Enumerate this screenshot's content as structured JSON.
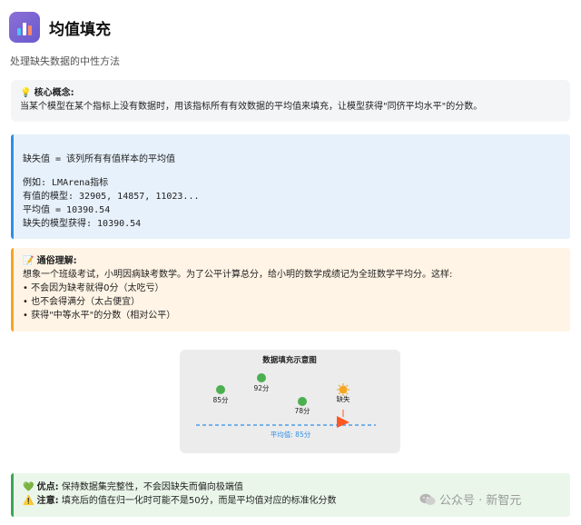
{
  "header": {
    "icon": "bar-chart-icon",
    "title": "均值填充"
  },
  "subtitle": "处理缺失数据的中性方法",
  "core": {
    "icon": "lightbulb-icon",
    "label": "核心概念:",
    "text": "当某个模型在某个指标上没有数据时，用该指标所有有效数据的平均值来填充，让模型获得\"同侪平均水平\"的分数。"
  },
  "formula": {
    "line1": "缺失值 = 该列所有有值样本的平均值",
    "line2": "例如: LMArena指标",
    "line3": "有值的模型: 32905, 14857, 11023...",
    "line4": "平均值 = 10390.54",
    "line5": "缺失的模型获得: 10390.54"
  },
  "plain": {
    "icon": "memo-icon",
    "label": "通俗理解:",
    "intro": "想象一个班级考试，小明因病缺考数学。为了公平计算总分，给小明的数学成绩记为全班数学平均分。这样:",
    "bullets": [
      "• 不会因为缺考就得0分（太吃亏）",
      "• 也不会得满分（太占便宜）",
      "• 获得\"中等水平\"的分数（相对公平）"
    ]
  },
  "diagram": {
    "title": "数据填充示意图",
    "points": [
      {
        "label": "85分",
        "color": "#4caf50"
      },
      {
        "label": "92分",
        "color": "#4caf50"
      },
      {
        "label": "78分",
        "color": "#4caf50"
      },
      {
        "label": "缺失",
        "color": "#f5a623"
      }
    ],
    "avg_label": "平均值: 85分",
    "avg_color": "#2f8fe8",
    "arrow_color": "#ff5722"
  },
  "bottom": {
    "pro_icon": "green-heart-icon",
    "pro_label": "优点:",
    "pro_text": "保持数据集完整性，不会因缺失而偏向极端值",
    "warn_icon": "warning-icon",
    "warn_label": "注意:",
    "warn_text": "填充后的值在归一化时可能不是50分，而是平均值对应的标准化分数"
  },
  "watermark": "公众号 · 新智元"
}
